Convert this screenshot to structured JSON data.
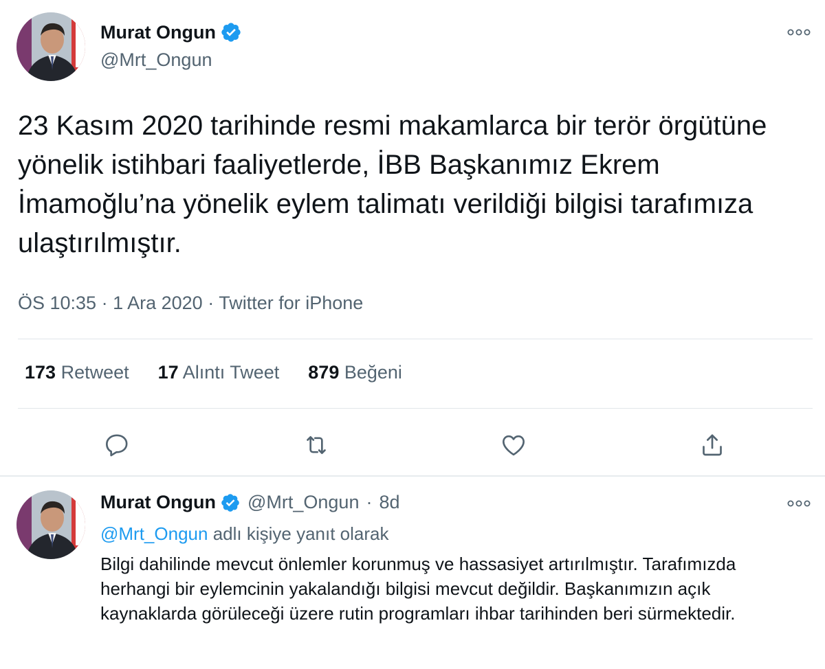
{
  "main_tweet": {
    "display_name": "Murat Ongun",
    "handle": "@Mrt_Ongun",
    "text": "23 Kasım 2020 tarihinde resmi makamlarca bir terör örgütüne yönelik istihbari faaliyetlerde, İBB Başkanımız Ekrem İmamoğlu’na yönelik eylem talimatı verildiği bilgisi tarafımıza ulaştırılmıştır.",
    "time": "ÖS 10:35",
    "date": "1 Ara 2020",
    "source": "Twitter for iPhone",
    "separator": " · ",
    "stats": {
      "retweets_count": "173",
      "retweets_label": "Retweet",
      "quotes_count": "17",
      "quotes_label": "Alıntı Tweet",
      "likes_count": "879",
      "likes_label": "Beğeni"
    },
    "icons": [
      "reply-icon",
      "retweet-icon",
      "like-icon",
      "share-icon",
      "more-icon",
      "verified-badge-icon"
    ]
  },
  "reply_tweet": {
    "display_name": "Murat Ongun",
    "handle": "@Mrt_Ongun",
    "age": "8d",
    "replying_to_handle": "@Mrt_Ongun",
    "replying_to_suffix": "adlı kişiye yanıt olarak",
    "text": "Bilgi dahilinde mevcut önlemler korunmuş ve hassasiyet artırılmıştır. Tarafımızda herhangi bir eylemcinin yakalandığı bilgisi mevcut değildir. Başkanımızın açık kaynaklarda görüleceği üzere rutin programları ihbar tarihinden beri sürmektedir."
  },
  "colors": {
    "verified_blue": "#1d9bf0",
    "text_primary": "#0f1419",
    "text_secondary": "#536471",
    "divider": "#e1e6ea"
  }
}
